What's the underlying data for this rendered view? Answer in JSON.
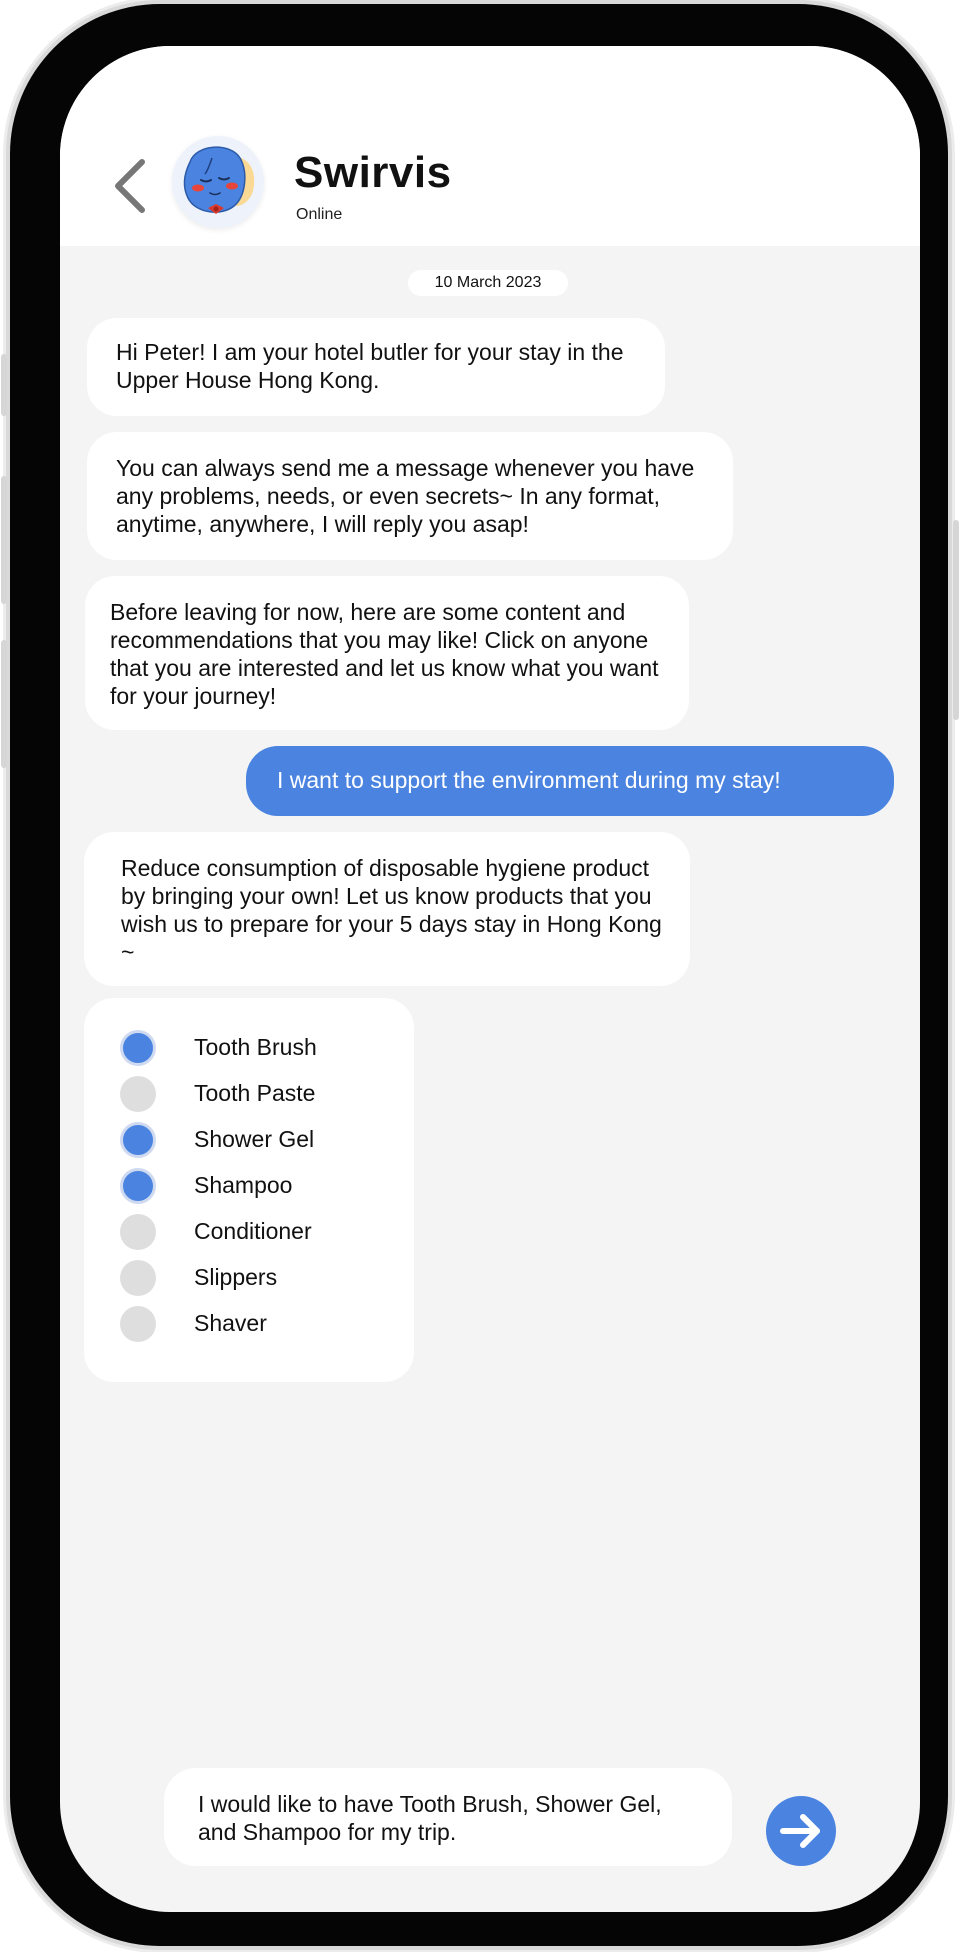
{
  "header": {
    "title": "Swirvis",
    "status": "Online"
  },
  "chat": {
    "date": "10 March 2023",
    "messages": [
      {
        "text": "Hi Peter! I am your hotel butler for your stay in the Upper House Hong Kong."
      },
      {
        "text": "You can always send me a message whenever you have any problems, needs, or even secrets~ In any format, anytime, anywhere, I will reply you asap!"
      },
      {
        "text": "Before leaving for now, here are some content and recommendations that you may like! Click on anyone that you are interested and let us know what you want for your journey!"
      },
      {
        "text": "I want to support the environment during my stay!"
      },
      {
        "text": "Reduce consumption of disposable hygiene product by bringing your own! Let us know products that you wish us to prepare for your 5 days stay in Hong Kong ~"
      }
    ],
    "options": [
      {
        "label": "Tooth Brush",
        "checked": true
      },
      {
        "label": "Tooth Paste",
        "checked": false
      },
      {
        "label": "Shower Gel",
        "checked": true
      },
      {
        "label": "Shampoo",
        "checked": true
      },
      {
        "label": "Conditioner",
        "checked": false
      },
      {
        "label": "Slippers",
        "checked": false
      },
      {
        "label": "Shaver",
        "checked": false
      }
    ]
  },
  "composer": {
    "value": "I would like to have Tooth Brush, Shower Gel, and Shampoo for my trip."
  },
  "colors": {
    "accent": "#4a84e0",
    "unchecked": "#dedede",
    "background": "#f4f4f4"
  }
}
